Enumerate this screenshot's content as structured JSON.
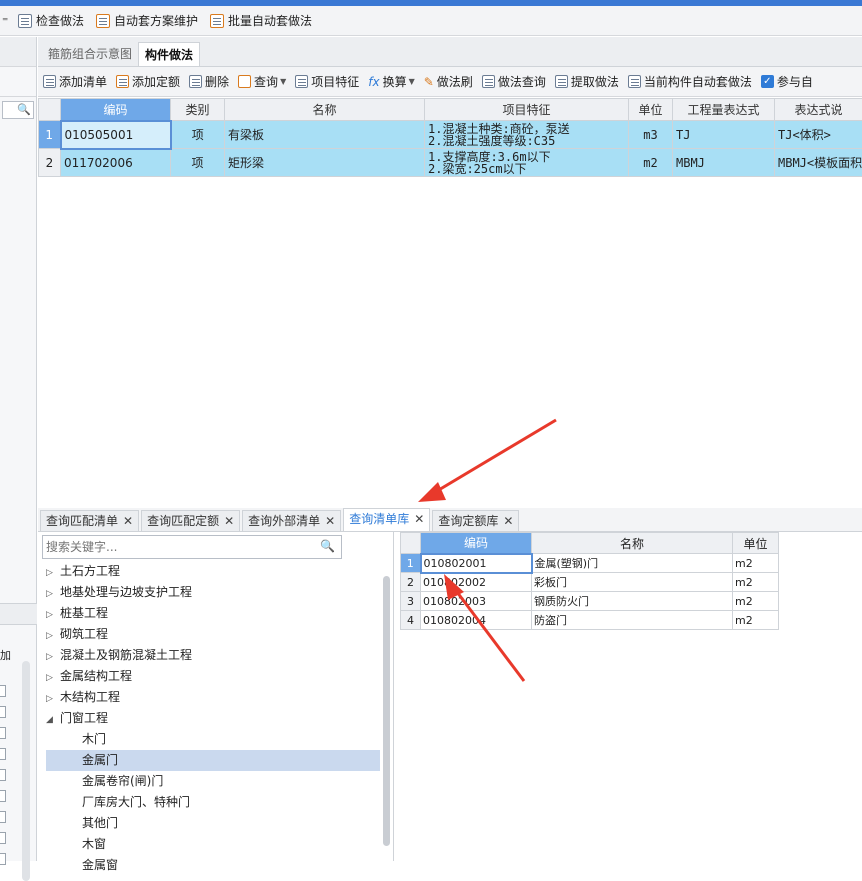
{
  "toolbar_top": {
    "items": [
      {
        "label": "检查做法",
        "icon": "check-doc-icon"
      },
      {
        "label": "自动套方案维护",
        "icon": "scheme-doc-icon"
      },
      {
        "label": "批量自动套做法",
        "icon": "batch-doc-icon"
      }
    ]
  },
  "main_tabs": [
    "箍筋组合示意图",
    "构件做法"
  ],
  "toolbar2": [
    {
      "label": "添加清单",
      "icon": "add-list-icon"
    },
    {
      "label": "添加定额",
      "icon": "add-quota-icon"
    },
    {
      "label": "删除",
      "icon": "delete-icon"
    },
    {
      "label": "查询",
      "icon": "query-icon",
      "dropdown": true
    },
    {
      "label": "项目特征",
      "icon": "feature-icon"
    },
    {
      "label": "换算",
      "icon": "fx-icon",
      "dropdown": true
    },
    {
      "label": "做法刷",
      "icon": "brush-icon"
    },
    {
      "label": "做法查询",
      "icon": "method-query-icon"
    },
    {
      "label": "提取做法",
      "icon": "extract-icon"
    },
    {
      "label": "当前构件自动套做法",
      "icon": "auto-apply-icon"
    },
    {
      "label": "参与自",
      "icon": "checkbox-icon"
    }
  ],
  "grid": {
    "headers": [
      "编码",
      "类别",
      "名称",
      "项目特征",
      "单位",
      "工程量表达式",
      "表达式说"
    ],
    "rows": [
      {
        "num": "1",
        "code": "010505001",
        "type": "项",
        "name": "有梁板",
        "feature1": "1.混凝土种类:商砼，泵送",
        "feature2": "2.混凝土强度等级:C35",
        "unit": "m3",
        "expr": "TJ",
        "expr_desc": "TJ<体积>"
      },
      {
        "num": "2",
        "code": "011702006",
        "type": "项",
        "name": "矩形梁",
        "feature1": "1.支撑高度:3.6m以下",
        "feature2": "2.梁宽:25cm以下",
        "unit": "m2",
        "expr": "MBMJ",
        "expr_desc": "MBMJ<模板面积>"
      }
    ]
  },
  "bottom_tabs": [
    {
      "label": "查询匹配清单"
    },
    {
      "label": "查询匹配定额"
    },
    {
      "label": "查询外部清单"
    },
    {
      "label": "查询清单库",
      "active": true
    },
    {
      "label": "查询定额库"
    }
  ],
  "search": {
    "placeholder": "搜索关键字..."
  },
  "tree": {
    "nodes": [
      "土石方工程",
      "地基处理与边坡支护工程",
      "桩基工程",
      "砌筑工程",
      "混凝土及钢筋混凝土工程",
      "金属结构工程",
      "木结构工程"
    ],
    "expanded": "门窗工程",
    "children": [
      "木门",
      "金属门",
      "金属卷帘(闸)门",
      "厂库房大门、特种门",
      "其他门",
      "木窗",
      "金属窗"
    ],
    "selected_child": "金属门"
  },
  "result_grid": {
    "headers": [
      "编码",
      "名称",
      "单位"
    ],
    "rows": [
      {
        "num": "1",
        "code": "010802001",
        "name": "金属(塑钢)门",
        "unit": "m2"
      },
      {
        "num": "2",
        "code": "010802002",
        "name": "彩板门",
        "unit": "m2"
      },
      {
        "num": "3",
        "code": "010802003",
        "name": "钢质防火门",
        "unit": "m2"
      },
      {
        "num": "4",
        "code": "010802004",
        "name": "防盗门",
        "unit": "m2"
      }
    ]
  },
  "left_panel_label": "加",
  "colors": {
    "accent": "#3a78d4",
    "highlight_row": "#a8dff5",
    "arrow": "#e8392b"
  }
}
